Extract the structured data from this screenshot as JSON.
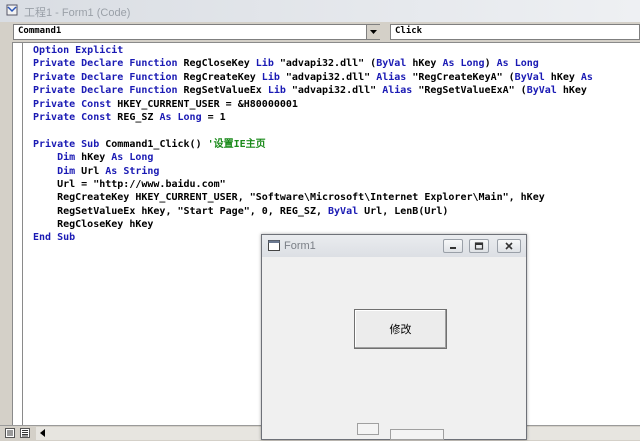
{
  "code_window": {
    "title": "工程1 - Form1 (Code)"
  },
  "object_combo": {
    "value": "Command1"
  },
  "procedure_combo": {
    "value": "Click"
  },
  "code_lines": [
    [
      {
        "t": "Option Explicit",
        "k": 1
      }
    ],
    [
      {
        "t": "Private Declare Function",
        "k": 1
      },
      {
        "t": " RegCloseKey ",
        "k": 0
      },
      {
        "t": "Lib",
        "k": 1
      },
      {
        "t": " \"advapi32.dll\" (",
        "k": 0
      },
      {
        "t": "ByVal",
        "k": 1
      },
      {
        "t": " hKey ",
        "k": 0
      },
      {
        "t": "As Long",
        "k": 1
      },
      {
        "t": ") ",
        "k": 0
      },
      {
        "t": "As Long",
        "k": 1
      }
    ],
    [
      {
        "t": "Private Declare Function",
        "k": 1
      },
      {
        "t": " RegCreateKey ",
        "k": 0
      },
      {
        "t": "Lib",
        "k": 1
      },
      {
        "t": " \"advapi32.dll\" ",
        "k": 0
      },
      {
        "t": "Alias",
        "k": 1
      },
      {
        "t": " \"RegCreateKeyA\" (",
        "k": 0
      },
      {
        "t": "ByVal",
        "k": 1
      },
      {
        "t": " hKey ",
        "k": 0
      },
      {
        "t": "As",
        "k": 1
      }
    ],
    [
      {
        "t": "Private Declare Function",
        "k": 1
      },
      {
        "t": " RegSetValueEx ",
        "k": 0
      },
      {
        "t": "Lib",
        "k": 1
      },
      {
        "t": " \"advapi32.dll\" ",
        "k": 0
      },
      {
        "t": "Alias",
        "k": 1
      },
      {
        "t": " \"RegSetValueExA\" (",
        "k": 0
      },
      {
        "t": "ByVal",
        "k": 1
      },
      {
        "t": " hKey",
        "k": 0
      }
    ],
    [
      {
        "t": "Private Const",
        "k": 1
      },
      {
        "t": " HKEY_CURRENT_USER = &H80000001",
        "k": 0
      }
    ],
    [
      {
        "t": "Private Const",
        "k": 1
      },
      {
        "t": " REG_SZ ",
        "k": 0
      },
      {
        "t": "As Long",
        "k": 1
      },
      {
        "t": " = 1",
        "k": 0
      }
    ],
    [
      {
        "t": "",
        "k": 0
      }
    ],
    [
      {
        "t": "Private Sub",
        "k": 1
      },
      {
        "t": " Command1_Click() ",
        "k": 0
      },
      {
        "t": "'设置IE主页",
        "k": 2
      }
    ],
    [
      {
        "t": "    ",
        "k": 0
      },
      {
        "t": "Dim",
        "k": 1
      },
      {
        "t": " hKey ",
        "k": 0
      },
      {
        "t": "As Long",
        "k": 1
      }
    ],
    [
      {
        "t": "    ",
        "k": 0
      },
      {
        "t": "Dim",
        "k": 1
      },
      {
        "t": " Url ",
        "k": 0
      },
      {
        "t": "As String",
        "k": 1
      }
    ],
    [
      {
        "t": "    Url = \"http://www.baidu.com\"",
        "k": 0
      }
    ],
    [
      {
        "t": "    RegCreateKey HKEY_CURRENT_USER, \"Software\\Microsoft\\Internet Explorer\\Main\", hKey",
        "k": 0
      }
    ],
    [
      {
        "t": "    RegSetValueEx hKey, \"Start Page\", 0, REG_SZ, ",
        "k": 0
      },
      {
        "t": "ByVal",
        "k": 1
      },
      {
        "t": " Url, LenB(Url)",
        "k": 0
      }
    ],
    [
      {
        "t": "    RegCloseKey hKey",
        "k": 0
      }
    ],
    [
      {
        "t": "End Sub",
        "k": 1
      }
    ]
  ],
  "form_window": {
    "title": "Form1",
    "button_label": "修改"
  },
  "colors": {
    "keyword": "#1a1ab4",
    "comment": "#1a8a1a",
    "text": "#000000"
  }
}
